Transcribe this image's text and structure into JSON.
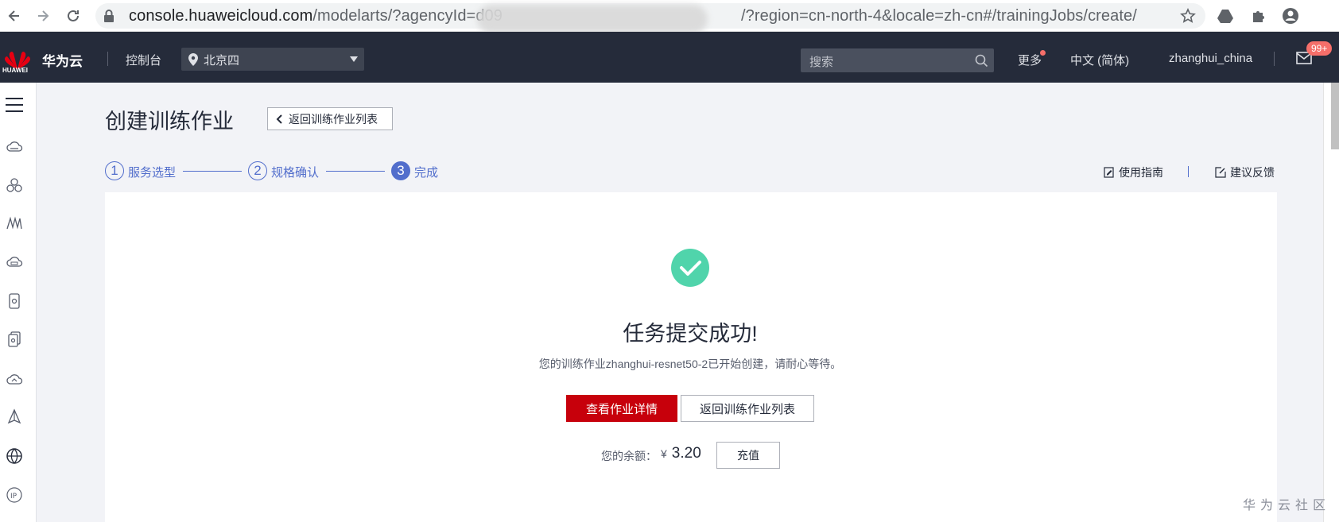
{
  "browser": {
    "url_host": "console.huaweicloud.com",
    "url_path_start": "/modelarts/?agencyId=d09",
    "url_path_end": "/?region=cn-north-4&locale=zh-cn#/trainingJobs/create/"
  },
  "header": {
    "logo_text": "HUAWEI",
    "brand": "华为云",
    "console": "控制台",
    "region": "北京四",
    "search_placeholder": "搜索",
    "more": "更多",
    "language": "中文 (简体)",
    "username": "zhanghui_china",
    "message_badge": "99+"
  },
  "page": {
    "title": "创建训练作业",
    "back_button": "返回训练作业列表",
    "steps": [
      {
        "number": "1",
        "label": "服务选型"
      },
      {
        "number": "2",
        "label": "规格确认"
      },
      {
        "number": "3",
        "label": "完成"
      }
    ],
    "guide_link": "使用指南",
    "feedback_link": "建议反馈"
  },
  "result": {
    "title": "任务提交成功!",
    "message": "您的训练作业zhanghui-resnet50-2已开始创建，请耐心等待。",
    "view_details_button": "查看作业详情",
    "back_list_button": "返回训练作业列表",
    "balance_label": "您的余额：",
    "currency": "¥",
    "balance_value": "3.20",
    "recharge_button": "充值"
  },
  "watermark": "华为云社区",
  "colors": {
    "brand_red": "#c7000b",
    "header_bg": "#252b3a",
    "step_blue": "#526ecc",
    "success_green": "#50d4ab"
  }
}
